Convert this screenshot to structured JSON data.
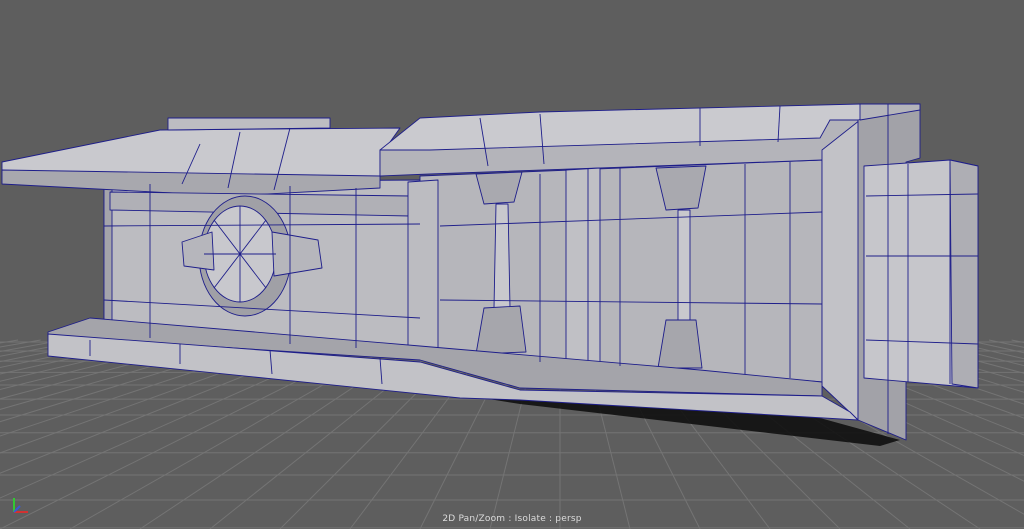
{
  "viewport": {
    "hud_text": "2D Pan/Zoom : Isolate : persp",
    "colors": {
      "background": "#5e5e5e",
      "grid_line": "#6e6e6e",
      "grid_major": "#3a3a3a",
      "model_face_light": "#c8c8cc",
      "model_face_mid": "#adadb2",
      "model_face_dark": "#8e8e94",
      "wireframe": "#1e1e8a",
      "shadow": "#000000"
    }
  },
  "axis_gizmo": {
    "x_color": "#d23232",
    "y_color": "#32c832",
    "z_color": "#3c5ad2"
  }
}
